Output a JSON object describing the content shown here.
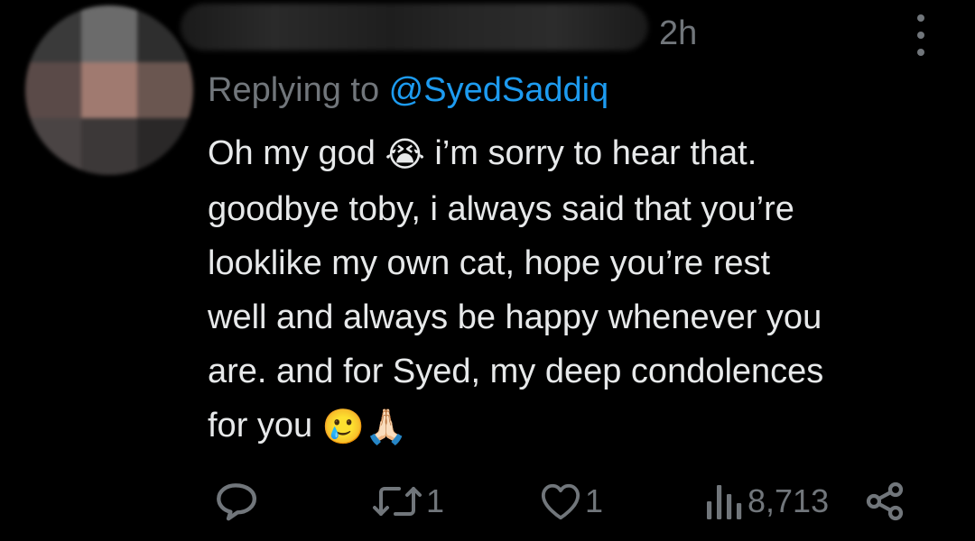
{
  "header": {
    "timestamp": "2h"
  },
  "reply": {
    "prefix": "Replying to ",
    "mention": "@SyedSaddiq"
  },
  "tweet": {
    "line1_pre": "Oh my god ",
    "line1_emoji": "😭",
    "line1_post": " i’m sorry to hear that.",
    "line2": "goodbye toby, i always said that you’re",
    "line3": "looklike my own cat, hope you’re rest",
    "line4": "well and always be happy whenever you",
    "line5": "are. and for Syed, my deep condolences",
    "line6_pre": "for you ",
    "line6_emoji1": "🥲",
    "line6_emoji2": "🙏🏻"
  },
  "actions": {
    "reply_icon": "reply-icon",
    "retweet_icon": "retweet-icon",
    "retweet_count": "1",
    "like_icon": "heart-icon",
    "like_count": "1",
    "views_icon": "views-icon",
    "views_count": "8,713",
    "share_icon": "share-icon"
  },
  "colors": {
    "background": "#000000",
    "text": "#e7e9ea",
    "muted": "#71767b",
    "link": "#1d9bf0"
  }
}
